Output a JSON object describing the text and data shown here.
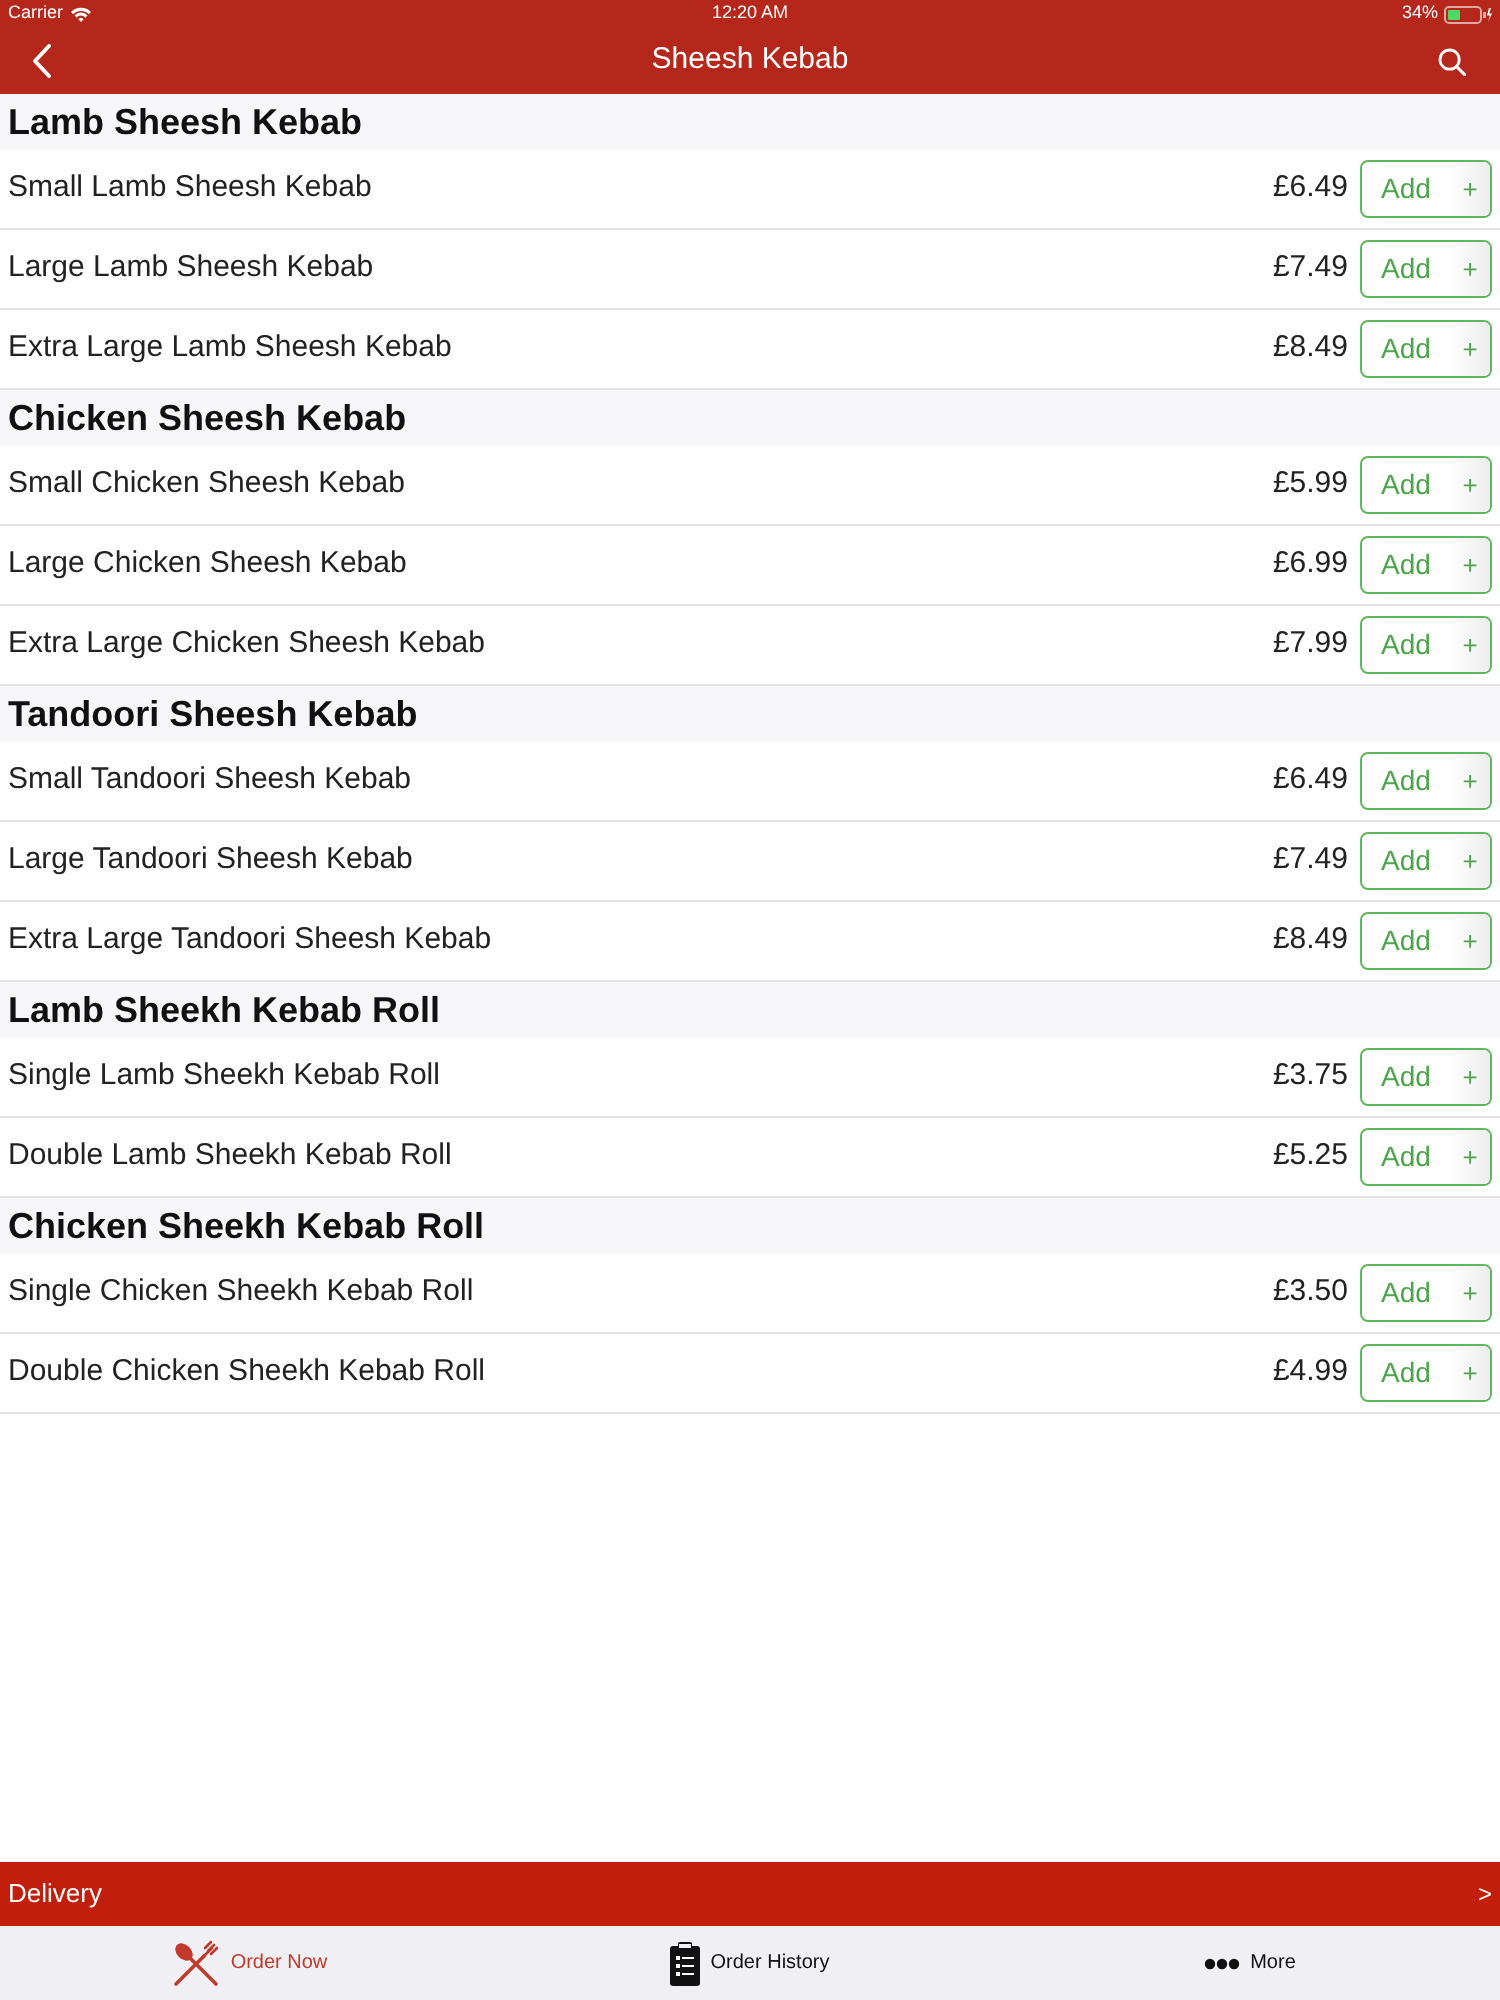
{
  "status_bar": {
    "carrier": "Carrier",
    "time": "12:20 AM",
    "battery": "34%"
  },
  "nav_bar": {
    "title": "Sheesh Kebab"
  },
  "sections": [
    {
      "title": "Lamb Sheesh Kebab",
      "items": [
        {
          "name": "Small Lamb Sheesh Kebab",
          "price": "£6.49",
          "button": "Add",
          "button_plus": "+"
        },
        {
          "name": "Large Lamb Sheesh Kebab",
          "price": "£7.49",
          "button": "Add",
          "button_plus": "+"
        },
        {
          "name": "Extra Large Lamb Sheesh Kebab",
          "price": "£8.49",
          "button": "Add",
          "button_plus": "+"
        }
      ]
    },
    {
      "title": "Chicken Sheesh Kebab",
      "items": [
        {
          "name": "Small Chicken Sheesh Kebab",
          "price": "£5.99",
          "button": "Add",
          "button_plus": "+"
        },
        {
          "name": "Large Chicken Sheesh Kebab",
          "price": "£6.99",
          "button": "Add",
          "button_plus": "+"
        },
        {
          "name": "Extra Large Chicken Sheesh Kebab",
          "price": "£7.99",
          "button": "Add",
          "button_plus": "+"
        }
      ]
    },
    {
      "title": "Tandoori Sheesh Kebab",
      "items": [
        {
          "name": "Small Tandoori Sheesh Kebab",
          "price": "£6.49",
          "button": "Add",
          "button_plus": "+"
        },
        {
          "name": "Large Tandoori Sheesh Kebab",
          "price": "£7.49",
          "button": "Add",
          "button_plus": "+"
        },
        {
          "name": "Extra Large Tandoori Sheesh Kebab",
          "price": "£8.49",
          "button": "Add",
          "button_plus": "+"
        }
      ]
    },
    {
      "title": "Lamb Sheekh Kebab Roll",
      "items": [
        {
          "name": "Single Lamb Sheekh Kebab Roll",
          "price": "£3.75",
          "button": "Add",
          "button_plus": "+"
        },
        {
          "name": "Double Lamb Sheekh Kebab Roll",
          "price": "£5.25",
          "button": "Add",
          "button_plus": "+"
        }
      ]
    },
    {
      "title": "Chicken Sheekh Kebab Roll",
      "items": [
        {
          "name": "Single Chicken Sheekh Kebab Roll",
          "price": "£3.50",
          "button": "Add",
          "button_plus": "+"
        },
        {
          "name": "Double Chicken Sheekh Kebab Roll",
          "price": "£4.99",
          "button": "Add",
          "button_plus": "+"
        }
      ]
    }
  ],
  "delivery_bar": {
    "label": "Delivery",
    "arrow": ">"
  },
  "tab_bar": [
    {
      "label": "Order Now",
      "selected": true,
      "kind": "utensils"
    },
    {
      "label": "Order History",
      "selected": false,
      "kind": "clipboard"
    },
    {
      "label": "More",
      "selected": false,
      "kind": "dots"
    }
  ]
}
